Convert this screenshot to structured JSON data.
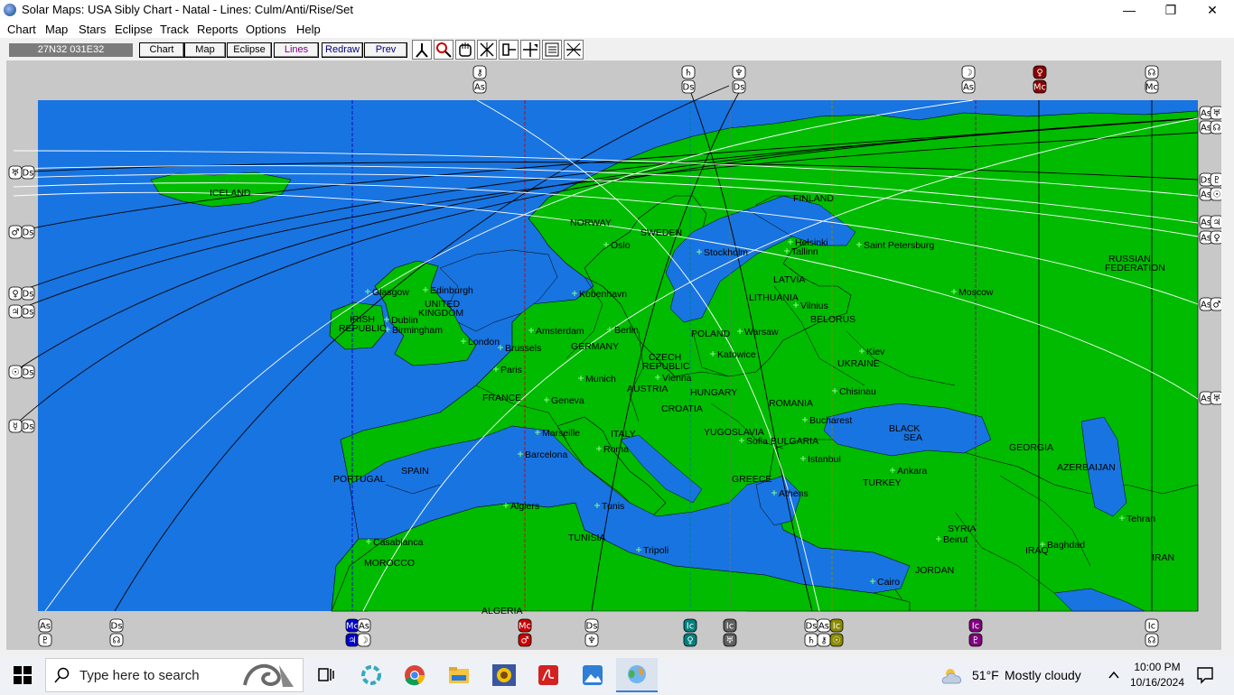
{
  "window": {
    "title": "Solar Maps: USA Sibly Chart - Natal - Lines: Culm/Anti/Rise/Set",
    "minimize": "—",
    "restore": "❐",
    "close": "✕"
  },
  "menu": [
    "Chart",
    "Map",
    "Stars",
    "Eclipse",
    "Track",
    "Reports",
    "Options",
    "Help"
  ],
  "toolbar": {
    "coords": "27N32  031E32",
    "buttons": [
      "Chart",
      "Map",
      "Eclipse",
      "Lines",
      "Redraw",
      "Prev"
    ]
  },
  "map": {
    "labels": [
      {
        "t": "ICELAND",
        "c": "country"
      },
      {
        "t": "NORWAY",
        "c": "country"
      },
      {
        "t": "SWEDEN",
        "c": "country"
      },
      {
        "t": "FINLAND",
        "c": "country"
      },
      {
        "t": "Oslo",
        "c": "city"
      },
      {
        "t": "Stockholm",
        "c": "city"
      },
      {
        "t": "Helsinki",
        "c": "city"
      },
      {
        "t": "Tallinn",
        "c": "city"
      },
      {
        "t": "Saint Petersburg",
        "c": "city"
      },
      {
        "t": "RUSSIAN",
        "c": "country"
      },
      {
        "t": "FEDERATION",
        "c": "country"
      },
      {
        "t": "Glasgow",
        "c": "city"
      },
      {
        "t": "Edinburgh",
        "c": "city"
      },
      {
        "t": "UNITED",
        "c": "country"
      },
      {
        "t": "KINGDOM",
        "c": "country"
      },
      {
        "t": "IRISH",
        "c": "country"
      },
      {
        "t": "REPUBLIC",
        "c": "country"
      },
      {
        "t": "Dublin",
        "c": "city"
      },
      {
        "t": "Birmingham",
        "c": "city"
      },
      {
        "t": "London",
        "c": "city"
      },
      {
        "t": "Kobenhavn",
        "c": "city"
      },
      {
        "t": "LATVIA",
        "c": "country"
      },
      {
        "t": "LITHUANIA",
        "c": "country"
      },
      {
        "t": "Vilnius",
        "c": "city"
      },
      {
        "t": "BELORUS",
        "c": "country"
      },
      {
        "t": "Moscow",
        "c": "city"
      },
      {
        "t": "Amsterdam",
        "c": "city"
      },
      {
        "t": "Berlin",
        "c": "city"
      },
      {
        "t": "POLAND",
        "c": "country"
      },
      {
        "t": "Warsaw",
        "c": "city"
      },
      {
        "t": "Brussels",
        "c": "city"
      },
      {
        "t": "GERMANY",
        "c": "country"
      },
      {
        "t": "Katowice",
        "c": "city"
      },
      {
        "t": "Kiev",
        "c": "city"
      },
      {
        "t": "CZECH",
        "c": "country"
      },
      {
        "t": "REPUBLIC",
        "c": "country"
      },
      {
        "t": "Paris",
        "c": "city"
      },
      {
        "t": "UKRAINE",
        "c": "country"
      },
      {
        "t": "Munich",
        "c": "city"
      },
      {
        "t": "Vienna",
        "c": "city"
      },
      {
        "t": "AUSTRIA",
        "c": "country"
      },
      {
        "t": "HUNGARY",
        "c": "country"
      },
      {
        "t": "Chisinau",
        "c": "city"
      },
      {
        "t": "FRANCE",
        "c": "country"
      },
      {
        "t": "Geneva",
        "c": "city"
      },
      {
        "t": "ROMANIA",
        "c": "country"
      },
      {
        "t": "CROATIA",
        "c": "country"
      },
      {
        "t": "Bucharest",
        "c": "city"
      },
      {
        "t": "BLACK",
        "c": "sea"
      },
      {
        "t": "SEA",
        "c": "sea"
      },
      {
        "t": "Marseille",
        "c": "city"
      },
      {
        "t": "ITALY",
        "c": "country"
      },
      {
        "t": "YUGOSLAVIA",
        "c": "country"
      },
      {
        "t": "Sofia",
        "c": "city"
      },
      {
        "t": "BULGARIA",
        "c": "country"
      },
      {
        "t": "GEORGIA",
        "c": "country"
      },
      {
        "t": "Roma",
        "c": "city"
      },
      {
        "t": "Barcelona",
        "c": "city"
      },
      {
        "t": "Istanbul",
        "c": "city"
      },
      {
        "t": "Ankara",
        "c": "city"
      },
      {
        "t": "AZERBAIJAN",
        "c": "country"
      },
      {
        "t": "PORTUGAL",
        "c": "country"
      },
      {
        "t": "SPAIN",
        "c": "country"
      },
      {
        "t": "GREECE",
        "c": "country"
      },
      {
        "t": "TURKEY",
        "c": "country"
      },
      {
        "t": "Athens",
        "c": "city"
      },
      {
        "t": "Algiers",
        "c": "city"
      },
      {
        "t": "Tunis",
        "c": "city"
      },
      {
        "t": "Tehran",
        "c": "city"
      },
      {
        "t": "Casablanca",
        "c": "city"
      },
      {
        "t": "TUNISIA",
        "c": "country"
      },
      {
        "t": "SYRIA",
        "c": "country"
      },
      {
        "t": "Beirut",
        "c": "city"
      },
      {
        "t": "Tripoli",
        "c": "city"
      },
      {
        "t": "IRAQ",
        "c": "country"
      },
      {
        "t": "Baghdad",
        "c": "city"
      },
      {
        "t": "MOROCCO",
        "c": "country"
      },
      {
        "t": "IRAN",
        "c": "country"
      },
      {
        "t": "JORDAN",
        "c": "country"
      },
      {
        "t": "Cairo",
        "c": "city"
      },
      {
        "t": "ALGERIA",
        "c": "country"
      }
    ],
    "top_markers": [
      {
        "p": "⚷",
        "a": "As",
        "color": "#ffffff"
      },
      {
        "p": "♄",
        "a": "Ds",
        "color": "#ffffff"
      },
      {
        "p": "♆",
        "a": "Ds",
        "color": "#ffffff"
      },
      {
        "p": "☽",
        "a": "As",
        "color": "#ffffff"
      },
      {
        "p": "♀",
        "a": "Mc",
        "color": "#8b0000"
      },
      {
        "p": "☊",
        "a": "Mc",
        "color": "#ffffff"
      }
    ],
    "bottom_markers": [
      {
        "a": "As",
        "p": "♇",
        "color": "#ffffff"
      },
      {
        "a": "Ds",
        "p": "☊",
        "color": "#ffffff"
      },
      {
        "a": "Mc",
        "p": "♃",
        "color": "#0000cc"
      },
      {
        "a": "As",
        "p": "☽",
        "color": "#ffffff"
      },
      {
        "a": "Mc",
        "p": "♂",
        "color": "#cc0000"
      },
      {
        "a": "Ds",
        "p": "♆",
        "color": "#ffffff"
      },
      {
        "a": "Ic",
        "p": "♀",
        "color": "#008080"
      },
      {
        "a": "Ic",
        "p": "♅",
        "color": "#606060"
      },
      {
        "a": "Ds",
        "p": "♄",
        "color": "#ffffff"
      },
      {
        "a": "As",
        "p": "⚷",
        "color": "#ffffff"
      },
      {
        "a": "Ic",
        "p": "☉",
        "color": "#8b8b00"
      },
      {
        "a": "Ic",
        "p": "♇",
        "color": "#800080"
      },
      {
        "a": "Ic",
        "p": "☊",
        "color": "#ffffff"
      }
    ],
    "left_markers": [
      {
        "p": "♅",
        "a": "Ds"
      },
      {
        "p": "♂",
        "a": "Ds"
      },
      {
        "p": "♀",
        "a": "Ds"
      },
      {
        "p": "♃",
        "a": "Ds"
      },
      {
        "p": "☉",
        "a": "Ds"
      },
      {
        "p": "☿",
        "a": "Ds"
      }
    ],
    "right_markers": [
      {
        "a": "As",
        "p": "♅"
      },
      {
        "a": "As",
        "p": "☊"
      },
      {
        "a": "Ds",
        "p": "♇"
      },
      {
        "a": "As",
        "p": "☉"
      },
      {
        "a": "As",
        "p": "♃"
      },
      {
        "a": "As",
        "p": "♀"
      },
      {
        "a": "As",
        "p": "♂"
      },
      {
        "a": "As",
        "p": "♅"
      }
    ],
    "colors": {
      "water": "#1874e0",
      "land": "#00bb00",
      "border": "#000000",
      "city_mark": "#7fff7f"
    }
  },
  "taskbar": {
    "search_placeholder": "Type here to search",
    "weather_temp": "51°F",
    "weather_desc": "Mostly cloudy",
    "time": "10:00 PM",
    "date": "10/16/2024"
  }
}
